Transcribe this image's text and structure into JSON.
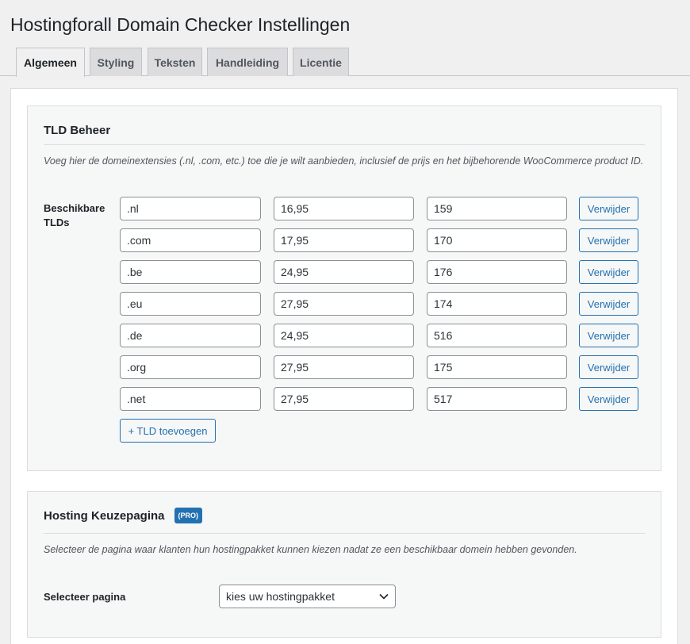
{
  "page": {
    "title": "Hostingforall Domain Checker Instellingen"
  },
  "tabs": [
    {
      "label": "Algemeen",
      "active": true
    },
    {
      "label": "Styling",
      "active": false
    },
    {
      "label": "Teksten",
      "active": false
    },
    {
      "label": "Handleiding",
      "active": false
    },
    {
      "label": "Licentie",
      "active": false
    }
  ],
  "tld_section": {
    "title": "TLD Beheer",
    "description": "Voeg hier de domeinextensies (.nl, .com, etc.) toe die je wilt aanbieden, inclusief de prijs en het bijbehorende WooCommerce product ID.",
    "field_label": "Beschikbare TLDs",
    "remove_label": "Verwijder",
    "add_label": "+ TLD toevoegen",
    "rows": [
      {
        "tld": ".nl",
        "price": "16,95",
        "product_id": "159"
      },
      {
        "tld": ".com",
        "price": "17,95",
        "product_id": "170"
      },
      {
        "tld": ".be",
        "price": "24,95",
        "product_id": "176"
      },
      {
        "tld": ".eu",
        "price": "27,95",
        "product_id": "174"
      },
      {
        "tld": ".de",
        "price": "24,95",
        "product_id": "516"
      },
      {
        "tld": ".org",
        "price": "27,95",
        "product_id": "175"
      },
      {
        "tld": ".net",
        "price": "27,95",
        "product_id": "517"
      }
    ]
  },
  "hosting_section": {
    "title": "Hosting Keuzepagina",
    "badge": "(PRO)",
    "description": "Selecteer de pagina waar klanten hun hostingpakket kunnen kiezen nadat ze een beschikbaar domein hebben gevonden.",
    "field_label": "Selecteer pagina",
    "selected_page": "kies uw hostingpakket",
    "chevron_icon": "chevron-down-icon"
  },
  "colors": {
    "accent": "#2271b1",
    "background": "#f0f0f1",
    "card": "#f6f7f7"
  }
}
